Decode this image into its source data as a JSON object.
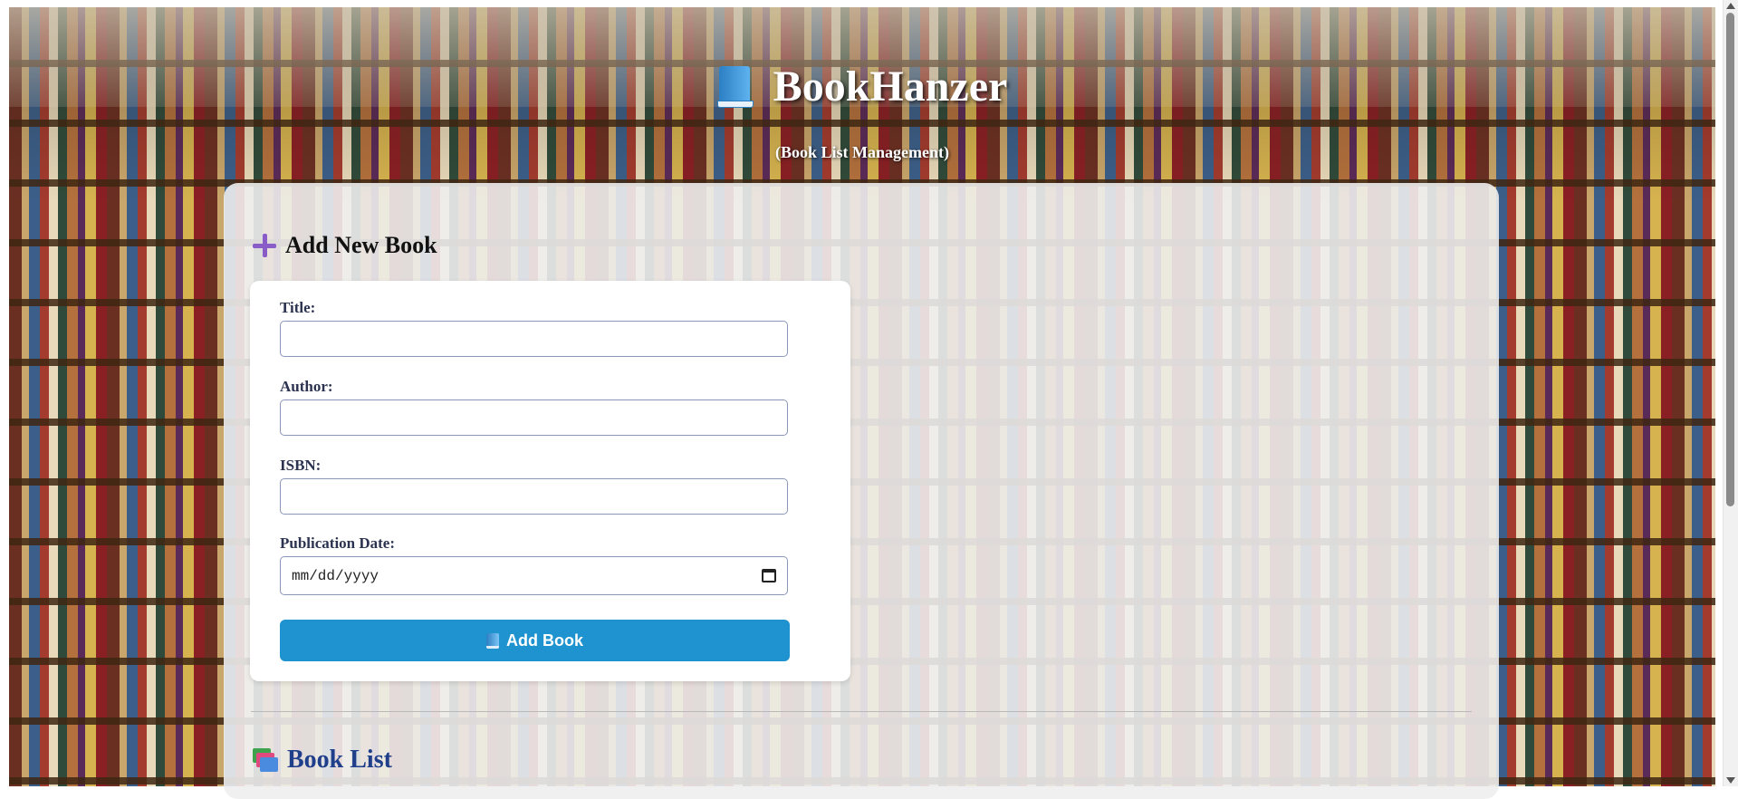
{
  "header": {
    "title": "BookHanzer",
    "subtitle": "(Book List Management)"
  },
  "add_section": {
    "heading": "Add New Book",
    "fields": {
      "title": {
        "label": "Title:",
        "value": ""
      },
      "author": {
        "label": "Author:",
        "value": ""
      },
      "isbn": {
        "label": "ISBN:",
        "value": ""
      },
      "publication_date": {
        "label": "Publication Date:",
        "placeholder": "mm/dd/yyyy"
      }
    },
    "submit_label": "Add Book"
  },
  "list_section": {
    "heading": "Book List"
  },
  "icons": {
    "brand": "blue-book-icon",
    "add": "plus-icon",
    "submit": "blue-book-icon",
    "list": "books-stack-icon",
    "date": "calendar-icon"
  },
  "colors": {
    "accent_button": "#1f93cf",
    "plus_icon": "#8a5cc8",
    "list_heading": "#1f3f8a"
  }
}
